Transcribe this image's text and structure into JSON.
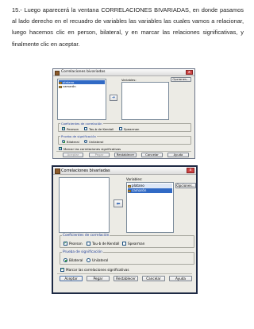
{
  "instruction": "15.- Luego aparecerá la ventana CORRELACIONES BIVARIADAS, en donde pasamos al lado derecho en el recuadro de variables las variables las cuales vamos a relacionar, luego hacemos clic en person, bilateral, y en marcar las relaciones significativas, y finalmente clic en aceptar.",
  "dialogs": [
    {
      "title": "Correlaciones bivariadas",
      "close_glyph": "x",
      "source_items": [
        "platano",
        "camarón"
      ],
      "variables_label": "Variables:",
      "variables_items": [],
      "options_button": "Opciones...",
      "arrow_glyph": "➜",
      "coef_group": "Coeficientes de correlación",
      "pearson": "Pearson",
      "kendall": "Tau-b de Kendall",
      "spearman": "Spearman",
      "sig_group": "Prueba de significación",
      "bilateral": "Bilateral",
      "unilateral": "Unilateral",
      "flag_label": "Marcar las correlaciones significativas",
      "buttons": [
        "Aceptar",
        "Pegar",
        "Restablecer",
        "Cancelar",
        "Ayuda"
      ]
    },
    {
      "title": "Correlaciones bivariadas",
      "close_glyph": "x",
      "source_items": [],
      "variables_label": "Variables:",
      "variables_items": [
        "platano",
        "camarón"
      ],
      "options_button": "Opciones...",
      "arrow_glyph": "⬅",
      "coef_group": "Coeficientes de correlación",
      "pearson": "Pearson",
      "kendall": "Tau-b de Kendall",
      "spearman": "Spearman",
      "sig_group": "Prueba de significación",
      "bilateral": "Bilateral",
      "unilateral": "Unilateral",
      "flag_label": "Marcar las correlaciones significativas",
      "buttons": [
        "Aceptar",
        "Pegar",
        "Restablecer",
        "Cancelar",
        "Ayuda"
      ]
    }
  ],
  "state": {
    "pearson_checked": true,
    "kendall_checked": false,
    "spearman_checked": false,
    "bilateral_selected": true,
    "flag_checked": true
  },
  "colors": {
    "dialog_bg": "#ecebe5",
    "group_title": "#1e3c96",
    "selection": "#316ac5",
    "check_green": "#1a8a1a"
  }
}
